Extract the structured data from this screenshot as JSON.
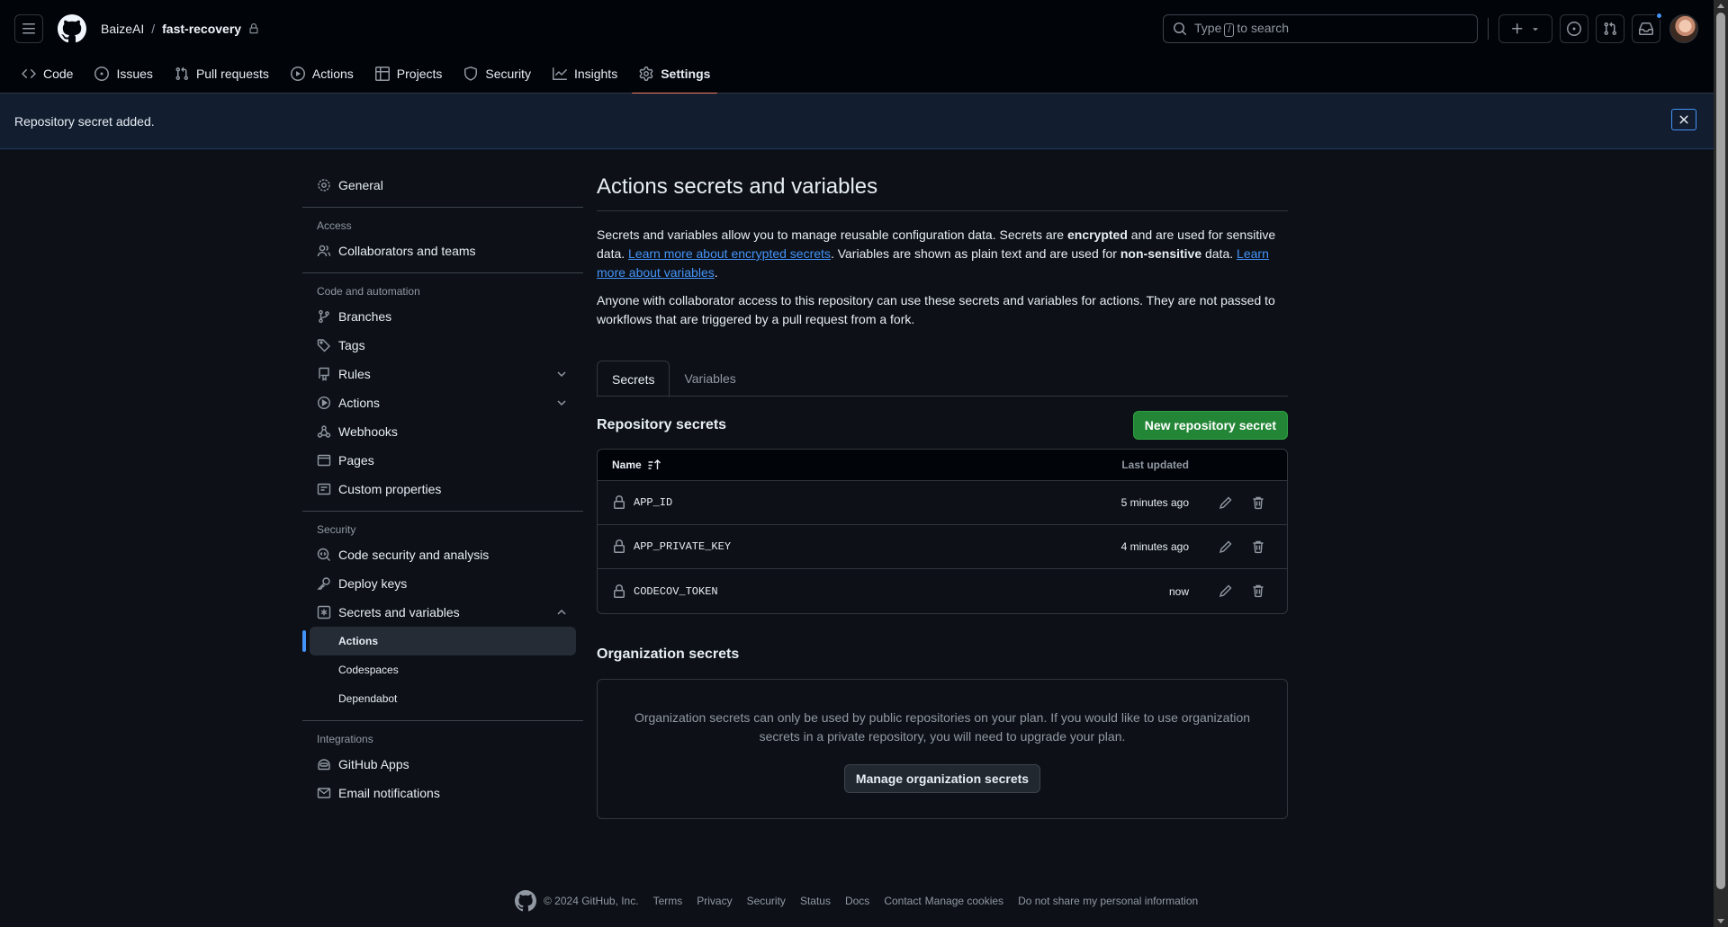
{
  "header": {
    "owner": "BaizeAI",
    "separator": "/",
    "repo": "fast-recovery",
    "search": {
      "prefix": "Type",
      "key": "/",
      "suffix": "to search"
    }
  },
  "tabs": [
    {
      "label": "Code",
      "icon": "code-icon"
    },
    {
      "label": "Issues",
      "icon": "issue-opened-icon"
    },
    {
      "label": "Pull requests",
      "icon": "git-pull-request-icon"
    },
    {
      "label": "Actions",
      "icon": "play-icon"
    },
    {
      "label": "Projects",
      "icon": "table-icon"
    },
    {
      "label": "Security",
      "icon": "shield-icon"
    },
    {
      "label": "Insights",
      "icon": "graph-icon"
    },
    {
      "label": "Settings",
      "icon": "gear-icon",
      "active": true
    }
  ],
  "flash": {
    "message": "Repository secret added."
  },
  "sidebar": {
    "general": "General",
    "access_heading": "Access",
    "collaborators": "Collaborators and teams",
    "code_heading": "Code and automation",
    "branches": "Branches",
    "tags": "Tags",
    "rules": "Rules",
    "actions": "Actions",
    "webhooks": "Webhooks",
    "pages": "Pages",
    "custom_properties": "Custom properties",
    "security_heading": "Security",
    "code_security": "Code security and analysis",
    "deploy_keys": "Deploy keys",
    "secrets_vars": "Secrets and variables",
    "sub_actions": "Actions",
    "sub_codespaces": "Codespaces",
    "sub_dependabot": "Dependabot",
    "integrations_heading": "Integrations",
    "github_apps": "GitHub Apps",
    "email_notifications": "Email notifications"
  },
  "main": {
    "title": "Actions secrets and variables",
    "p1": {
      "a": "Secrets and variables allow you to manage reusable configuration data. Secrets are ",
      "b": "encrypted",
      "c": " and are used for sensitive data. ",
      "link1": "Learn more about encrypted secrets",
      "d": ". Variables are shown as plain text and are used for ",
      "e": "non-sensitive",
      "f": " data. ",
      "link2": "Learn more about variables",
      "g": "."
    },
    "p2": "Anyone with collaborator access to this repository can use these secrets and variables for actions. They are not passed to workflows that are triggered by a pull request from a fork.",
    "tab_secrets": "Secrets",
    "tab_variables": "Variables",
    "repo_secrets_title": "Repository secrets",
    "new_secret_button": "New repository secret",
    "col_name": "Name",
    "col_updated": "Last updated",
    "secrets": [
      {
        "name": "APP_ID",
        "updated": "5 minutes ago"
      },
      {
        "name": "APP_PRIVATE_KEY",
        "updated": "4 minutes ago"
      },
      {
        "name": "CODECOV_TOKEN",
        "updated": "now"
      }
    ],
    "org_title": "Organization secrets",
    "org_text": "Organization secrets can only be used by public repositories on your plan. If you would like to use organization secrets in a private repository, you will need to upgrade your plan.",
    "org_button": "Manage organization secrets"
  },
  "footer": {
    "copyright": "© 2024 GitHub, Inc.",
    "links": [
      "Terms",
      "Privacy",
      "Security",
      "Status",
      "Docs",
      "Contact",
      "Manage cookies",
      "Do not share my personal information"
    ]
  },
  "colors": {
    "background": "#0d1117",
    "accent_tab": "#f78166",
    "primary_button": "#238636",
    "link": "#4493f8"
  }
}
